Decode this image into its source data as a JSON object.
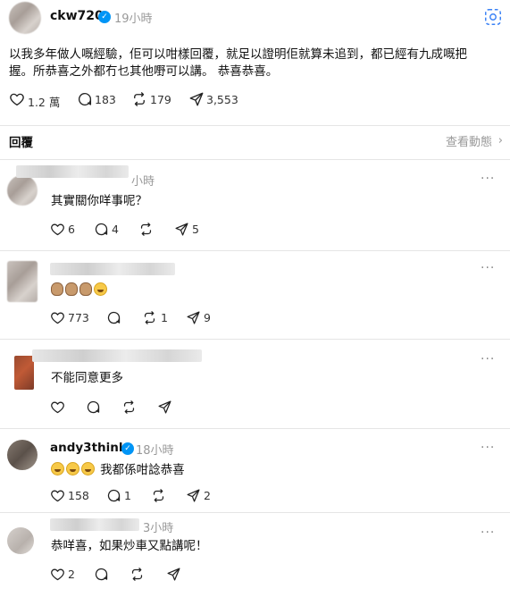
{
  "post": {
    "username": "ckw720",
    "time": "19小時",
    "text_line1": "以我多年做人嘅經驗，佢可以咁樣回覆，就足以證明佢就算未追到，都已經有九成嘅把",
    "text_line2": "握。所恭喜之外都冇乜其他嘢可以講。 恭喜恭喜。",
    "likes": "1.2 萬",
    "comments": "183",
    "reposts": "179",
    "shares": "3,553"
  },
  "replies_header": {
    "title": "回覆",
    "view_activity": "查看動態"
  },
  "replies": [
    {
      "time": "小時",
      "text": "其實關你咩事呢？",
      "likes": "6",
      "comments": "4",
      "reposts": "",
      "shares": "5"
    },
    {
      "text": "",
      "likes": "773",
      "comments": "",
      "reposts": "1",
      "shares": "9"
    },
    {
      "text": "不能同意更多",
      "likes": "",
      "comments": "",
      "reposts": "",
      "shares": ""
    },
    {
      "username": "andy3think",
      "time": "18小時",
      "text": "我都係咁諗恭喜",
      "likes": "158",
      "comments": "1",
      "reposts": "",
      "shares": "2"
    },
    {
      "time": "3小時",
      "text": "恭咩喜，如果炒車又點講呢！",
      "likes": "2",
      "comments": "",
      "reposts": "",
      "shares": ""
    }
  ],
  "icons": {
    "like": "heart-icon",
    "comment": "comment-bubble-icon",
    "repost": "repost-arrows-icon",
    "share": "send-paper-plane-icon",
    "more": "more-dots-icon",
    "translate": "translate-icon",
    "chevron": "chevron-right-icon"
  },
  "colors": {
    "verified": "#0095f6",
    "muted": "#999999"
  }
}
